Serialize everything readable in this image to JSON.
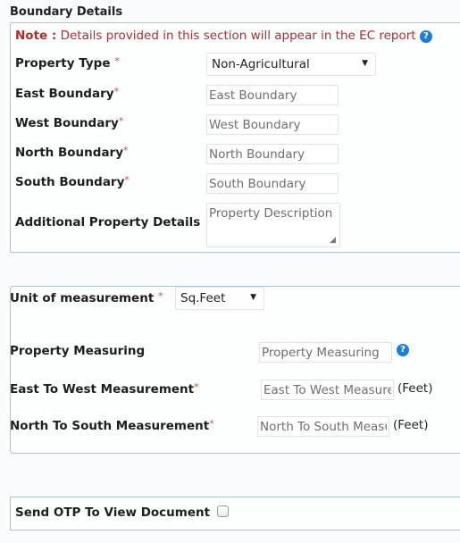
{
  "boundary": {
    "heading": "Boundary Details",
    "note_prefix": "Note :",
    "note_text": " Details provided in this section will appear in the EC report",
    "help_icon": "?",
    "property_type": {
      "label": "Property Type",
      "required": "*",
      "value": "Non-Agricultural",
      "caret": "▼"
    },
    "east": {
      "label": "East Boundary",
      "required": "*",
      "placeholder": "East Boundary"
    },
    "west": {
      "label": "West Boundary",
      "required": "*",
      "placeholder": "West Boundary"
    },
    "north": {
      "label": "North Boundary",
      "required": "*",
      "placeholder": "North Boundary"
    },
    "south": {
      "label": "South Boundary",
      "required": "*",
      "placeholder": "South Boundary"
    },
    "additional": {
      "label": "Additional Property Details",
      "placeholder": "Property Description"
    }
  },
  "measurement": {
    "unit": {
      "label": "Unit of measurement",
      "required": "*",
      "value": "Sq.Feet",
      "caret": "▼"
    },
    "property_measuring": {
      "label": "Property Measuring",
      "placeholder": "Property Measuring",
      "help_icon": "?"
    },
    "east_west": {
      "label": "East To West Measurement",
      "required": "*",
      "placeholder": "East To West Measurement",
      "unit": "(Feet)"
    },
    "north_south": {
      "label": "North To South Measurement",
      "required": "*",
      "placeholder": "North To South Measurement",
      "unit": "(Feet)"
    }
  },
  "otp": {
    "label": "Send OTP To View Document",
    "checked": false
  },
  "colors": {
    "note_red": "#b22c2c",
    "help_blue": "#1c7fd6",
    "panel_border": "#a9c3d6"
  }
}
